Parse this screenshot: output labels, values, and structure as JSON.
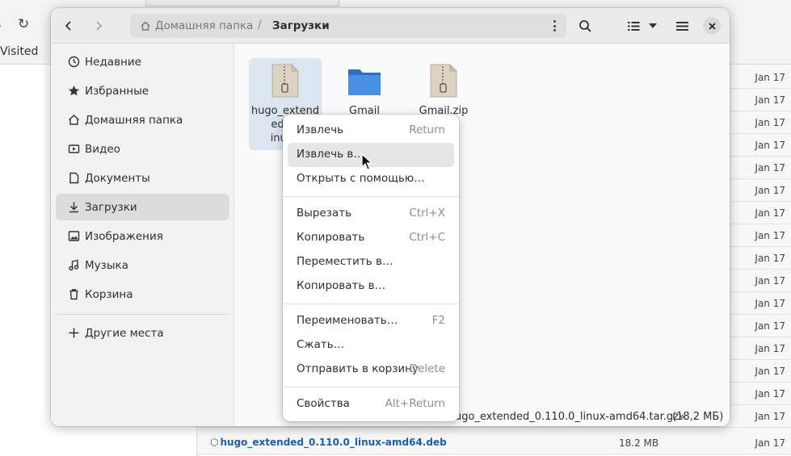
{
  "background": {
    "visited_label": "Visited",
    "rows": [
      {
        "date": "Jan 17"
      },
      {
        "date": "Jan 17"
      },
      {
        "date": "Jan 17"
      },
      {
        "date": "Jan 17"
      },
      {
        "date": "Jan 17"
      },
      {
        "date": "Jan 17"
      },
      {
        "date": "Jan 17"
      },
      {
        "date": "Jan 17"
      },
      {
        "date": "Jan 17"
      },
      {
        "date": "Jan 17"
      },
      {
        "date": "Jan 17"
      },
      {
        "date": "Jan 17"
      },
      {
        "date": "Jan 17"
      },
      {
        "date": "Jan 17"
      },
      {
        "date": "Jan 17"
      },
      {
        "date": "Jan 17"
      },
      {
        "date": "Jan 17"
      }
    ],
    "last_row": {
      "name": "hugo_extended_0.110.0_linux-amd64.deb",
      "size": "18.2 MB",
      "date": "Jan 17"
    }
  },
  "file_manager": {
    "path": {
      "home": "Домашняя папка",
      "separator": "/",
      "current": "Загрузки"
    },
    "sidebar": {
      "items": [
        {
          "label": "Недавние",
          "icon": "clock-icon"
        },
        {
          "label": "Избранные",
          "icon": "star-icon"
        },
        {
          "label": "Домашняя папка",
          "icon": "home-icon"
        },
        {
          "label": "Видео",
          "icon": "video-icon"
        },
        {
          "label": "Документы",
          "icon": "document-icon"
        },
        {
          "label": "Загрузки",
          "icon": "download-icon",
          "active": true
        },
        {
          "label": "Изображения",
          "icon": "image-icon"
        },
        {
          "label": "Музыка",
          "icon": "music-icon"
        },
        {
          "label": "Корзина",
          "icon": "trash-icon"
        }
      ],
      "other_places": "Другие места"
    },
    "files": [
      {
        "name": "hugo_extend ed_0. inux-.",
        "line1": "hugo_extend",
        "line2": "ed_0.",
        "line3": "inux-.",
        "icon": "archive-icon"
      },
      {
        "name": "Gmail",
        "icon": "folder-icon"
      },
      {
        "name": "Gmail.zip",
        "icon": "archive-icon"
      }
    ],
    "status": {
      "selected": "ugo_extended_0.110.0_linux-amd64.tar.gz»",
      "size": "(18,2 МБ)"
    }
  },
  "context_menu": {
    "items": [
      {
        "label": "Извлечь",
        "shortcut": "Return"
      },
      {
        "label": "Извлечь в…",
        "shortcut": ""
      },
      {
        "label": "Открыть с помощью…",
        "shortcut": ""
      },
      {
        "label": "Вырезать",
        "shortcut": "Ctrl+X"
      },
      {
        "label": "Копировать",
        "shortcut": "Ctrl+C"
      },
      {
        "label": "Переместить в…",
        "shortcut": ""
      },
      {
        "label": "Копировать в…",
        "shortcut": ""
      },
      {
        "label": "Переименовать…",
        "shortcut": "F2"
      },
      {
        "label": "Сжать…",
        "shortcut": ""
      },
      {
        "label": "Отправить в корзину",
        "shortcut": "Delete"
      },
      {
        "label": "Свойства",
        "shortcut": "Alt+Return"
      }
    ]
  },
  "colors": {
    "accent": "#1a5fb4",
    "folder": "#3d84d6",
    "selection": "#dce6f1"
  }
}
